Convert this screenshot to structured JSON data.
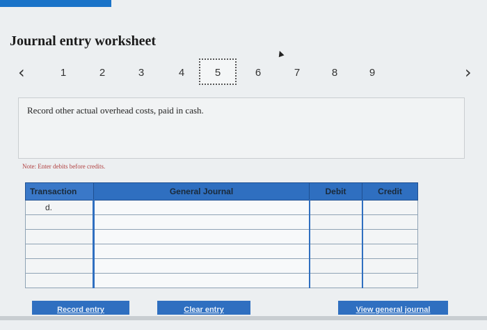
{
  "header": {
    "title": "Journal entry worksheet"
  },
  "pager": {
    "prev_icon": "‹",
    "next_icon": "›",
    "steps": [
      "1",
      "2",
      "3",
      "4",
      "5",
      "6",
      "7",
      "8",
      "9"
    ],
    "active_step": "5"
  },
  "instruction": {
    "text": "Record other actual overhead costs, paid in cash."
  },
  "note": "Note: Enter debits before credits.",
  "table": {
    "headers": {
      "transaction": "Transaction",
      "account": "General Journal",
      "debit": "Debit",
      "credit": "Credit"
    },
    "rows": [
      {
        "transaction": "d.",
        "account": "",
        "debit": "",
        "credit": ""
      },
      {
        "transaction": "",
        "account": "",
        "debit": "",
        "credit": ""
      },
      {
        "transaction": "",
        "account": "",
        "debit": "",
        "credit": ""
      },
      {
        "transaction": "",
        "account": "",
        "debit": "",
        "credit": ""
      },
      {
        "transaction": "",
        "account": "",
        "debit": "",
        "credit": ""
      },
      {
        "transaction": "",
        "account": "",
        "debit": "",
        "credit": ""
      }
    ]
  },
  "buttons": {
    "record": "Record entry",
    "clear": "Clear entry",
    "view": "View general journal"
  },
  "colors": {
    "accent": "#2f6fc0",
    "note": "#b04040"
  }
}
